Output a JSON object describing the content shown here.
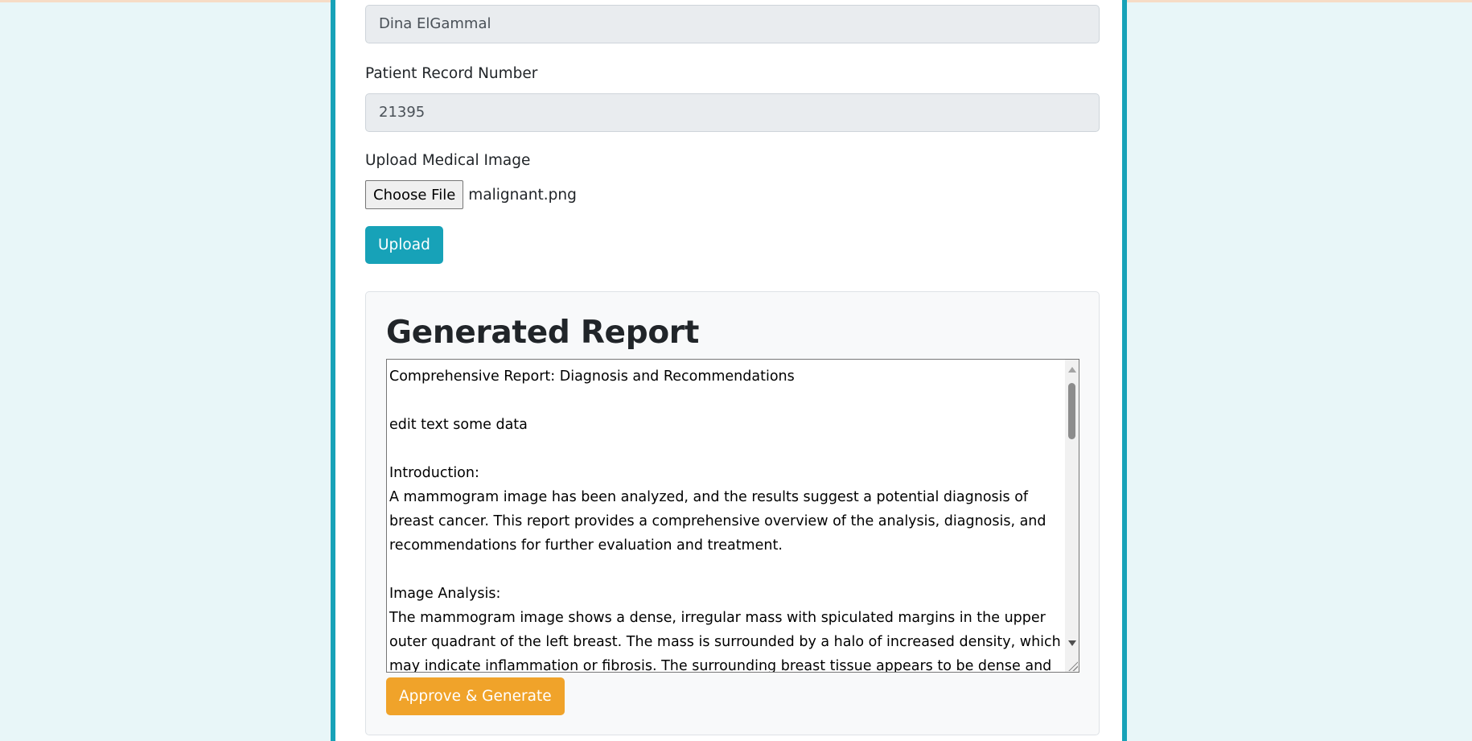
{
  "form": {
    "name_value": "Dina ElGammal",
    "record_label": "Patient Record Number",
    "record_value": "21395",
    "upload_label": "Upload Medical Image",
    "choose_file_label": "Choose File",
    "file_name": "malignant.png",
    "upload_button": "Upload"
  },
  "report": {
    "title": "Generated Report",
    "text": "Comprehensive Report: Diagnosis and Recommendations\n\nedit text some data\n\nIntroduction:\nA mammogram image has been analyzed, and the results suggest a potential diagnosis of breast cancer. This report provides a comprehensive overview of the analysis, diagnosis, and recommendations for further evaluation and treatment.\n\nImage Analysis:\nThe mammogram image shows a dense, irregular mass with spiculated margins in the upper outer quadrant of the left breast. The mass is surrounded by a halo of increased density, which may indicate inflammation or fibrosis. The surrounding breast tissue appears to be dense and",
    "approve_button": "Approve & Generate"
  },
  "colors": {
    "page_background": "#e8f6f8",
    "accent_teal": "#17a2b8",
    "approve_orange": "#f0a32a"
  }
}
